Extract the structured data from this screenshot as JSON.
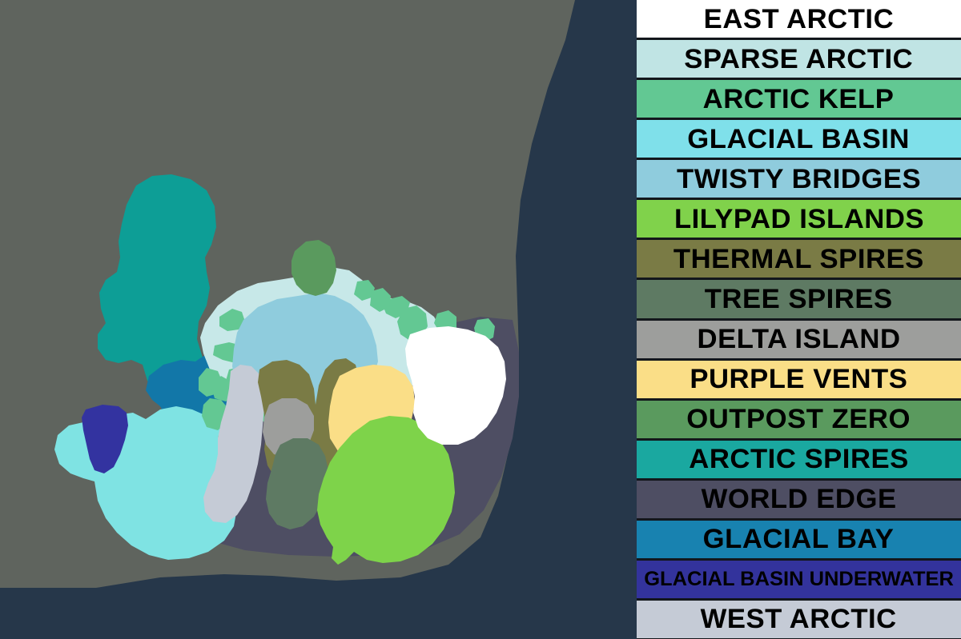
{
  "map": {
    "background_color": "#5f645e",
    "ocean_color": "#26374a",
    "regions": [
      {
        "name": "Arctic Spires",
        "color": "#0d9e96"
      },
      {
        "name": "Glacial Bay",
        "color": "#1277a8"
      },
      {
        "name": "Glacial Basin",
        "color": "#7fe3e3"
      },
      {
        "name": "Glacial Basin Underwater",
        "color": "#3333a0"
      },
      {
        "name": "Sparse Arctic",
        "color": "#c7e8e8"
      },
      {
        "name": "Arctic Kelp",
        "color": "#63c893"
      },
      {
        "name": "Twisty Bridges",
        "color": "#8fccdd"
      },
      {
        "name": "West Arctic",
        "color": "#c5cbd6"
      },
      {
        "name": "Thermal Spires",
        "color": "#7a7b45"
      },
      {
        "name": "Delta Island",
        "color": "#9d9e9c"
      },
      {
        "name": "Tree Spires",
        "color": "#5e7a63"
      },
      {
        "name": "Outpost Zero",
        "color": "#5a9a5e"
      },
      {
        "name": "Purple Vents",
        "color": "#fade87"
      },
      {
        "name": "Lilypad Islands",
        "color": "#7ed34a"
      },
      {
        "name": "East Arctic",
        "color": "#ffffff"
      },
      {
        "name": "World Edge",
        "color": "#4e4e63"
      }
    ]
  },
  "legend": {
    "items": [
      {
        "label": "EAST ARCTIC",
        "color": "#ffffff",
        "small": false
      },
      {
        "label": "SPARSE ARCTIC",
        "color": "#c0e4e4",
        "small": false
      },
      {
        "label": "ARCTIC KELP",
        "color": "#62c893",
        "small": false
      },
      {
        "label": "GLACIAL BASIN",
        "color": "#7fe0ea",
        "small": false
      },
      {
        "label": "TWISTY BRIDGES",
        "color": "#8fccdd",
        "small": false
      },
      {
        "label": "LILYPAD ISLANDS",
        "color": "#80d24b",
        "small": false
      },
      {
        "label": "THERMAL SPIRES",
        "color": "#7a7b45",
        "small": false
      },
      {
        "label": "TREE SPIRES",
        "color": "#5e7a63",
        "small": false
      },
      {
        "label": "DELTA ISLAND",
        "color": "#9d9e9c",
        "small": false
      },
      {
        "label": "PURPLE VENTS",
        "color": "#fade87",
        "small": false
      },
      {
        "label": "OUTPOST ZERO",
        "color": "#5a9a5e",
        "small": false
      },
      {
        "label": "ARCTIC SPIRES",
        "color": "#1aa8a0",
        "small": false
      },
      {
        "label": "WORLD EDGE",
        "color": "#4e4e63",
        "small": false
      },
      {
        "label": "GLACIAL BAY",
        "color": "#1882b0",
        "small": false
      },
      {
        "label": "GLACIAL BASIN UNDERWATER",
        "color": "#33339c",
        "small": true
      },
      {
        "label": "WEST ARCTIC",
        "color": "#c5cbd6",
        "small": false
      }
    ]
  }
}
